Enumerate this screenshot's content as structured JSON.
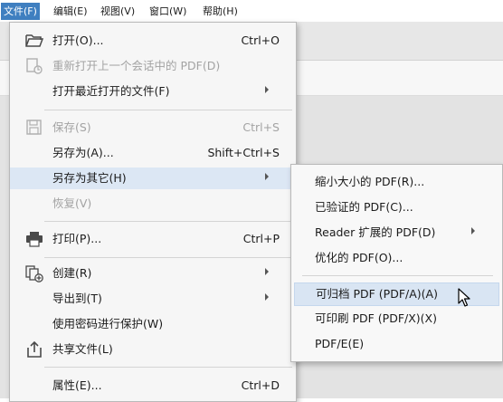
{
  "menubar": {
    "items": [
      "文件(F)",
      "编辑(E)",
      "视图(V)",
      "窗口(W)",
      "帮助(H)"
    ],
    "active_index": 0
  },
  "file_menu": {
    "items": [
      {
        "label": "打开(O)...",
        "accel": "Ctrl+O",
        "icon": "folder-open-icon",
        "disabled": false
      },
      {
        "label": "重新打开上一个会话中的 PDF(D)",
        "accel": "",
        "icon": "reopen-icon",
        "disabled": true
      },
      {
        "label": "打开最近打开的文件(F)",
        "accel": "",
        "submenu": true,
        "disabled": false
      },
      {
        "label": "保存(S)",
        "accel": "Ctrl+S",
        "icon": "save-icon",
        "disabled": true
      },
      {
        "label": "另存为(A)...",
        "accel": "Shift+Ctrl+S",
        "disabled": false
      },
      {
        "label": "另存为其它(H)",
        "accel": "",
        "submenu": true,
        "highlighted": true,
        "disabled": false
      },
      {
        "label": "恢复(V)",
        "accel": "",
        "disabled": true
      },
      {
        "label": "打印(P)...",
        "accel": "Ctrl+P",
        "icon": "printer-icon",
        "disabled": false
      },
      {
        "label": "创建(R)",
        "accel": "",
        "submenu": true,
        "icon": "create-pdf-icon",
        "disabled": false
      },
      {
        "label": "导出到(T)",
        "accel": "",
        "submenu": true,
        "disabled": false
      },
      {
        "label": "使用密码进行保护(W)",
        "accel": "",
        "disabled": false
      },
      {
        "label": "共享文件(L)",
        "accel": "",
        "icon": "share-icon",
        "disabled": false
      },
      {
        "label": "属性(E)...",
        "accel": "Ctrl+D",
        "disabled": false
      }
    ]
  },
  "save_as_other_menu": {
    "items": [
      {
        "label": "缩小大小的 PDF(R)..."
      },
      {
        "label": "已验证的 PDF(C)..."
      },
      {
        "label": "Reader 扩展的 PDF(D)",
        "submenu": true
      },
      {
        "label": "优化的 PDF(O)..."
      },
      {
        "label": "可归档 PDF (PDF/A)(A)",
        "highlighted": true
      },
      {
        "label": "可印刷 PDF (PDF/X)(X)"
      },
      {
        "label": "PDF/E(E)"
      }
    ]
  },
  "colors": {
    "menubar_active": "#3f7fc0",
    "menu_highlight": "#dce7f4",
    "disabled_text": "#a3a3a3"
  }
}
